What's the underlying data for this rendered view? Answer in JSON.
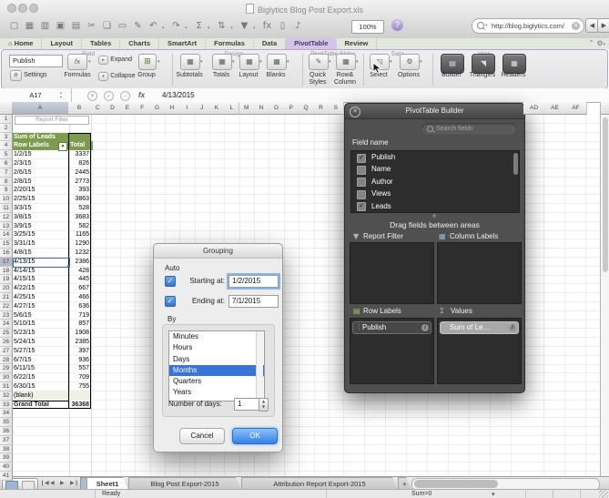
{
  "colors": {
    "accent": "#d5c3ea",
    "pivot_green": "#7d9b4e",
    "selection_blue": "#3875d7",
    "ok_blue": "#3181ea"
  },
  "window": {
    "title": "Biglytics Blog Post Export.xls",
    "zoom_level": "100%",
    "help": "?",
    "search_value": "http://blog.biglytics.com/",
    "back": "◀",
    "forward": "▶"
  },
  "toolbar": {
    "icons": [
      {
        "glyph": "▢",
        "name": "new-icon",
        "dd": false
      },
      {
        "glyph": "▦",
        "name": "open-icon",
        "dd": false
      },
      {
        "glyph": "▥",
        "name": "workbook-gallery-icon",
        "dd": false
      },
      {
        "glyph": "▣",
        "name": "save-icon",
        "dd": false
      },
      {
        "glyph": "▤",
        "name": "print-icon",
        "dd": false
      },
      {
        "glyph": "✂",
        "name": "cut-icon",
        "dd": false
      },
      {
        "glyph": "❏",
        "name": "copy-icon",
        "dd": false
      },
      {
        "glyph": "▭",
        "name": "paste-icon",
        "dd": false
      },
      {
        "glyph": "✎",
        "name": "format-painter-icon",
        "dd": false
      },
      {
        "glyph": "↶",
        "name": "undo-icon",
        "dd": true
      },
      {
        "glyph": "↷",
        "name": "redo-icon",
        "dd": true
      },
      {
        "glyph": "Σ",
        "name": "autosum-icon",
        "dd": true
      },
      {
        "glyph": "⇅",
        "name": "sort-icon",
        "dd": true
      },
      {
        "glyph": "▼",
        "name": "filter-icon",
        "dd": true
      },
      {
        "glyph": "fx",
        "name": "insert-function-icon",
        "dd": false
      },
      {
        "glyph": "▯",
        "name": "notebook-icon",
        "dd": false
      },
      {
        "glyph": "♪",
        "name": "media-browser-icon",
        "dd": false
      }
    ]
  },
  "ribbon_tabs": {
    "items": [
      "Home",
      "Layout",
      "Tables",
      "Charts",
      "SmartArt",
      "Formulas",
      "Data",
      "PivotTable",
      "Review"
    ],
    "active": "PivotTable",
    "home_icon": "⌂",
    "collapse_icon": "⌃",
    "gear_icon": "⚙"
  },
  "ribbon": {
    "field": {
      "label": "Field",
      "publish_value": "Publish",
      "settings": "Settings",
      "formulas": "Formulas",
      "formulas_glyph": "fx",
      "expand": "Expand",
      "collapse": "Collapse",
      "group": "Group",
      "group_glyph": "⊞"
    },
    "design": {
      "label": "Design",
      "buttons": [
        "Subtotals",
        "Totals",
        "Layout",
        "Blanks"
      ],
      "glyph": "▦"
    },
    "styles": {
      "label": "PivotTable Styles",
      "buttons": [
        "Quick Styles",
        "Row& Column"
      ],
      "glyphs": [
        "✎",
        "▦"
      ]
    },
    "data": {
      "label": "Data",
      "buttons": [
        "Select",
        "Options"
      ],
      "glyphs": [
        "◹",
        "⚙"
      ]
    },
    "view": {
      "label": "View",
      "buttons": [
        "Builder",
        "Triangles",
        "Headers"
      ],
      "glyphs": [
        "▤",
        "◥",
        "▦"
      ]
    }
  },
  "formula_bar": {
    "name_box": "A17",
    "cancel": "✕",
    "enter": "✓",
    "minus": "−",
    "fx": "fx",
    "value": "4/13/2015"
  },
  "grid": {
    "col_a": "A",
    "col_b": "B",
    "col_letters": [
      "C",
      "D",
      "E",
      "F",
      "G",
      "H",
      "I",
      "J",
      "K",
      "L",
      "M",
      "N",
      "O",
      "P",
      "Q",
      "R",
      "S"
    ],
    "col_letters_right": [
      "AD",
      "AE",
      "AF"
    ],
    "row_count": 41,
    "selected_row": 17,
    "report_filter": "Report Filter",
    "pivot": {
      "title": "Sum of Leads",
      "row_label_header": "Row Labels",
      "filter_arrow": "▼",
      "value_header": "Total",
      "rows": [
        [
          "1/2/15",
          "3337"
        ],
        [
          "2/3/15",
          "826"
        ],
        [
          "2/6/15",
          "2445"
        ],
        [
          "2/8/15",
          "2773"
        ],
        [
          "2/20/15",
          "393"
        ],
        [
          "2/25/15",
          "3863"
        ],
        [
          "3/3/15",
          "528"
        ],
        [
          "3/8/15",
          "3683"
        ],
        [
          "3/9/15",
          "582"
        ],
        [
          "3/25/15",
          "1165"
        ],
        [
          "3/31/15",
          "1290"
        ],
        [
          "4/8/15",
          "1232"
        ],
        [
          "4/13/15",
          "2386"
        ],
        [
          "4/14/15",
          "428"
        ],
        [
          "4/15/15",
          "445"
        ],
        [
          "4/22/15",
          "667"
        ],
        [
          "4/25/15",
          "466"
        ],
        [
          "4/27/15",
          "636"
        ],
        [
          "5/6/15",
          "719"
        ],
        [
          "5/10/15",
          "857"
        ],
        [
          "5/23/15",
          "1908"
        ],
        [
          "5/24/15",
          "2385"
        ],
        [
          "5/27/15",
          "397"
        ],
        [
          "6/7/15",
          "936"
        ],
        [
          "6/11/15",
          "557"
        ],
        [
          "6/22/15",
          "709"
        ],
        [
          "6/30/15",
          "755"
        ],
        [
          "(blank)",
          ""
        ]
      ],
      "grand_total_label": "Grand Total",
      "grand_total": "36368"
    }
  },
  "builder": {
    "title": "PivotTable Builder",
    "close": "✕",
    "search_placeholder": "Search fields",
    "field_name_label": "Field name",
    "fields": [
      {
        "name": "Publish",
        "checked": true
      },
      {
        "name": "Name",
        "checked": false
      },
      {
        "name": "Author",
        "checked": false
      },
      {
        "name": "Views",
        "checked": false
      },
      {
        "name": "Leads",
        "checked": true
      }
    ],
    "check_glyph": "✓",
    "drag_hint": "Drag fields between areas",
    "areas": {
      "report_filter": "Report Filter",
      "column_labels": "Column Labels",
      "row_labels": "Row Labels",
      "values": "Values"
    },
    "area_icons": {
      "report_filter": "▼",
      "column_labels": "▦",
      "row_labels": "▤",
      "values": "Σ"
    },
    "row_labels_pill": "Publish",
    "values_pill": "Sum of Le…",
    "pill_grip": "⋮",
    "pill_info": "i"
  },
  "grouping": {
    "title": "Grouping",
    "auto_label": "Auto",
    "check_glyph": "✓",
    "starting_label": "Starting at:",
    "starting_value": "1/2/2015",
    "ending_label": "Ending at:",
    "ending_value": "7/1/2015",
    "by_label": "By",
    "options": [
      "Minutes",
      "Hours",
      "Days",
      "Months",
      "Quarters",
      "Years"
    ],
    "selected_option": "Months",
    "days_label": "Number of days:",
    "days_value": "1",
    "cancel_label": "Cancel",
    "ok_label": "OK"
  },
  "sheet_tabs": {
    "items": [
      "Sheet1",
      "Blog Post Export-2015",
      "Attribution Report Export-2015"
    ],
    "active": "Sheet1",
    "add_label": "+",
    "nav": [
      "❙◀",
      "◀",
      "▶",
      "▶❙"
    ]
  },
  "status": {
    "ready": "Ready",
    "sum": "Sum=0",
    "caret": "▾"
  }
}
